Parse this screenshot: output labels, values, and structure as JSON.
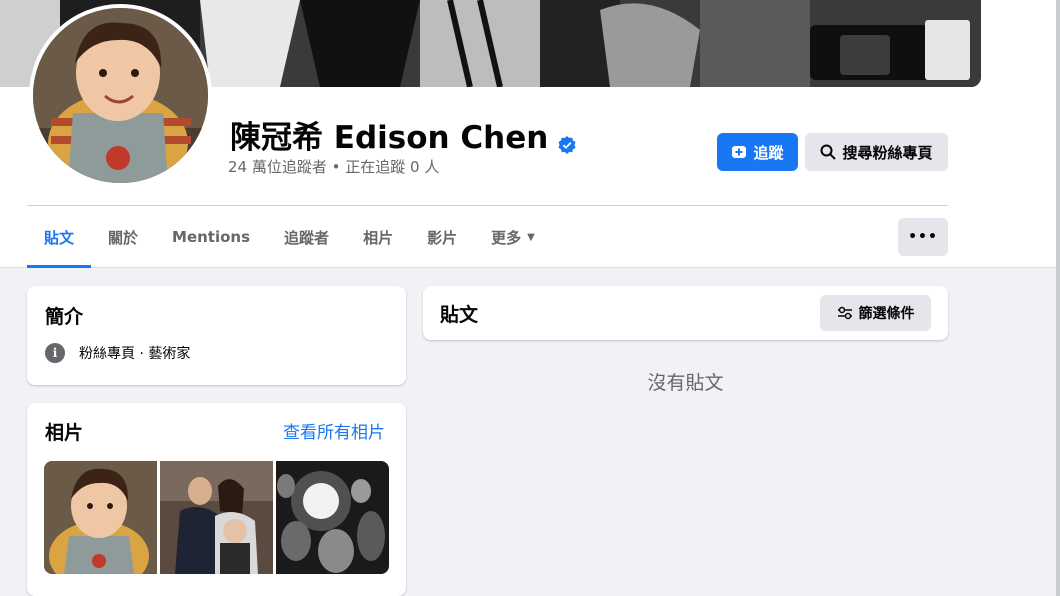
{
  "profile": {
    "name": "陳冠希 Edison Chen",
    "stats": "24 萬位追蹤者 • 正在追蹤 0 人"
  },
  "actions": {
    "follow_label": "追蹤",
    "search_label": "搜尋粉絲專頁",
    "more_label": "•••"
  },
  "tabs": [
    {
      "label": "貼文",
      "active": true
    },
    {
      "label": "關於"
    },
    {
      "label": "Mentions"
    },
    {
      "label": "追蹤者"
    },
    {
      "label": "相片"
    },
    {
      "label": "影片"
    },
    {
      "label": "更多"
    }
  ],
  "intro": {
    "title": "簡介",
    "category": "粉絲專頁 · 藝術家"
  },
  "photos": {
    "title": "相片",
    "see_all": "查看所有相片"
  },
  "posts": {
    "title": "貼文",
    "filter_label": "篩選條件",
    "empty_text": "沒有貼文"
  },
  "colors": {
    "accent": "#1877f2",
    "background": "#f0f2f5",
    "secondary_text": "#65676b"
  },
  "icons": [
    "verified-badge-icon",
    "add-follow-icon",
    "search-icon",
    "chevron-down-icon",
    "info-icon",
    "filter-sliders-icon"
  ]
}
